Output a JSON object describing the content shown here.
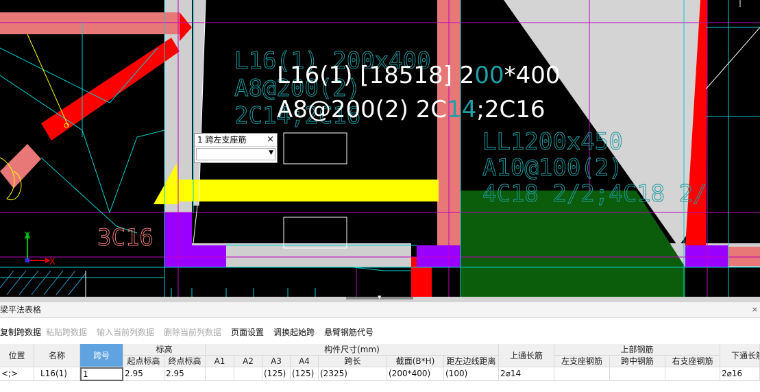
{
  "cad": {
    "beam_text_line1_a": "L16(1) [18518] 2",
    "beam_text_line1_b": "00",
    "beam_text_line1_c": "*400",
    "beam_text_line2_a": "A8@200(2) 2C",
    "beam_text_line2_b": "14",
    "beam_text_line2_c": ";2C16",
    "ghost_text_1": "L16(1) 200x400",
    "ghost_text_2": "A8@200(2)",
    "ghost_text_3": "2C14;2C16",
    "ll_text_1": "LL1200x450",
    "ll_text_2": "A10@100(2)",
    "ll_text_3": "4C18 2/2;4C18 2/",
    "rebar_text": "3C16",
    "axis_x": "X",
    "axis_y": "Y"
  },
  "popup": {
    "title": "1 跨左支座筋",
    "close": "×",
    "value": ""
  },
  "panel": {
    "title": "梁平法表格",
    "close": "×"
  },
  "toolbar": {
    "copy": "复制跨数据",
    "paste": "粘贴跨数据",
    "input_col": "输入当前列数据",
    "delete_col": "删除当前列数据",
    "page_setup": "页面设置",
    "swap_start": "调换起始跨",
    "cantilever": "悬臂钢筋代号"
  },
  "table": {
    "headers": {
      "position": "位置",
      "name": "名称",
      "span_no": "跨号",
      "elevation": "标高",
      "start_elev": "起点标高",
      "end_elev": "终点标高",
      "dims": "构件尺寸(mm)",
      "a1": "A1",
      "a2": "A2",
      "a3": "A3",
      "a4": "A4",
      "span_len": "跨长",
      "section": "截面(B*H)",
      "left_edge": "距左边线距离",
      "top_through": "上通长筋",
      "top_rebar": "上部钢筋",
      "left_support": "左支座钢筋",
      "mid_span": "跨中钢筋",
      "right_support": "右支座钢筋",
      "bottom_through": "下通长筋"
    },
    "row": {
      "position": "<;>",
      "name": "L16(1)",
      "span_no": "1",
      "start_elev": "2.95",
      "end_elev": "2.95",
      "a1": "",
      "a2": "",
      "a3": "(125)",
      "a4": "(125)",
      "span_len": "(2325)",
      "section": "(200*400)",
      "left_edge": "(100)",
      "top_through": "2⌀14",
      "left_support": "",
      "mid_span": "",
      "right_support": "",
      "bottom_through": "2⌀16"
    }
  }
}
